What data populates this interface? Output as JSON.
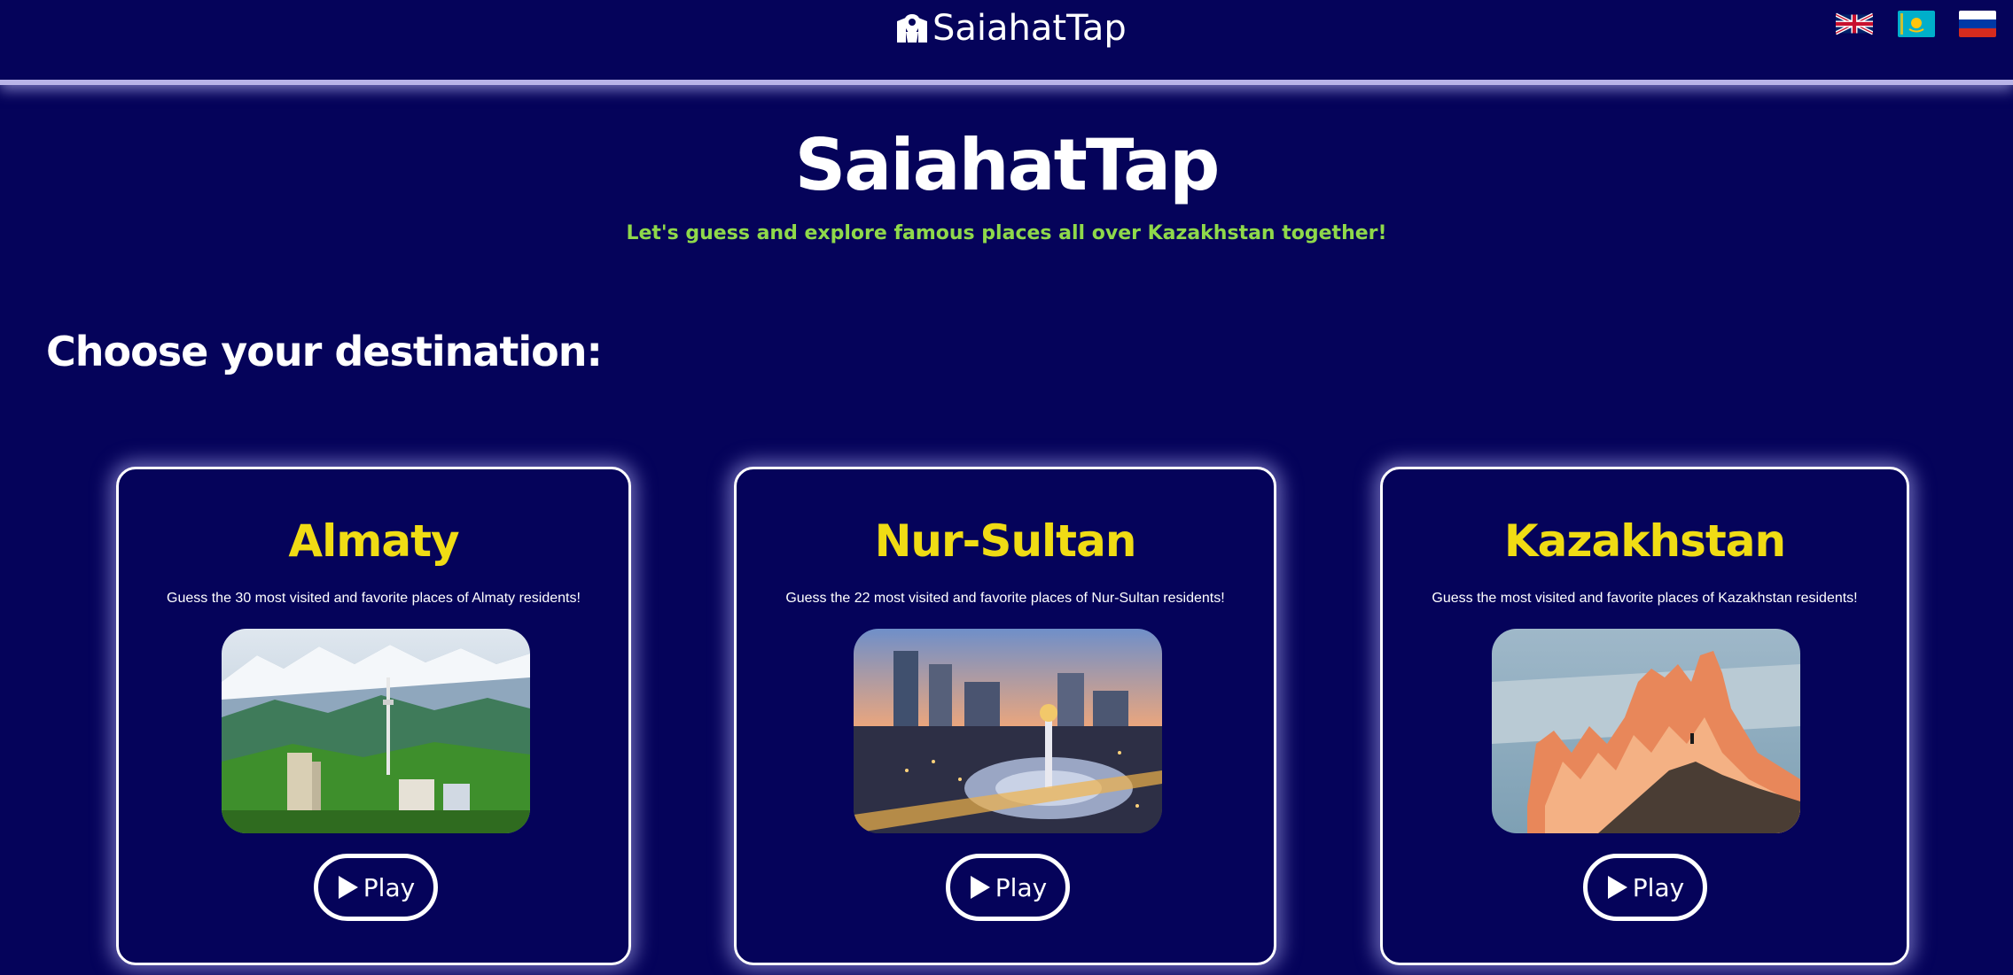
{
  "header": {
    "brand": "SaiahatTap",
    "languages": [
      {
        "code": "en",
        "icon": "uk-flag-icon"
      },
      {
        "code": "kz",
        "icon": "kz-flag-icon"
      },
      {
        "code": "ru",
        "icon": "ru-flag-icon"
      }
    ]
  },
  "hero": {
    "title": "SaiahatTap",
    "subtitle": "Let's guess and explore famous places all over Kazakhstan together!"
  },
  "section": {
    "heading": "Choose your destination:"
  },
  "cards": [
    {
      "title": "Almaty",
      "description": "Guess the 30 most visited and favorite places of Almaty residents!",
      "play_label": "Play",
      "image": "almaty-mountains-tv-tower"
    },
    {
      "title": "Nur-Sultan",
      "description": "Guess the 22 most visited and favorite places of Nur-Sultan residents!",
      "play_label": "Play",
      "image": "nur-sultan-city-night"
    },
    {
      "title": "Kazakhstan",
      "description": "Guess the most visited and favorite places of Kazakhstan residents!",
      "play_label": "Play",
      "image": "kazakhstan-canyon-rocks"
    }
  ],
  "colors": {
    "background": "#05035a",
    "accent_title": "#f0dc14",
    "accent_subtitle": "#8fd94a",
    "text": "#ffffff"
  }
}
